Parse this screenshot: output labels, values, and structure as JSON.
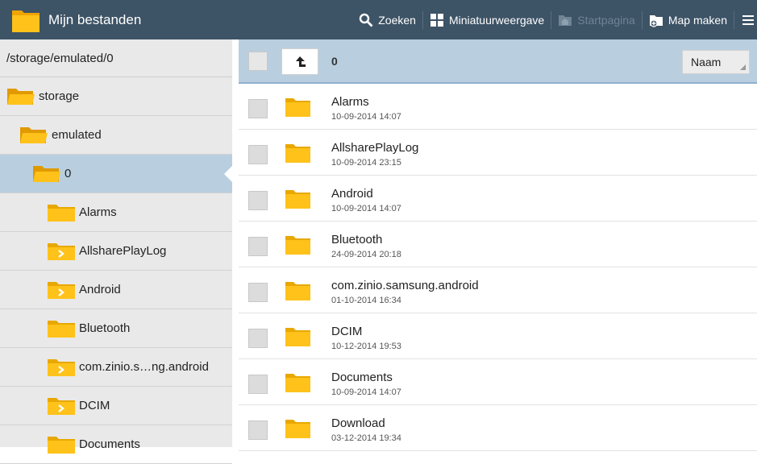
{
  "app": {
    "title": "Mijn bestanden"
  },
  "actions": [
    {
      "label": "Zoeken",
      "icon": "search-icon"
    },
    {
      "label": "Miniatuurweergave",
      "icon": "grid-icon"
    },
    {
      "label": "Startpagina",
      "icon": "home-folder-icon",
      "disabled": true
    },
    {
      "label": "Map maken",
      "icon": "new-folder-icon"
    }
  ],
  "tree": {
    "path": "/storage/emulated/0",
    "items": [
      {
        "label": "storage",
        "level": 0,
        "open": true
      },
      {
        "label": "emulated",
        "level": 1,
        "open": true
      },
      {
        "label": "0",
        "level": 2,
        "open": true,
        "selected": true
      },
      {
        "label": "Alarms",
        "level": 3,
        "expandable": false
      },
      {
        "label": "AllsharePlayLog",
        "level": 3,
        "expandable": true
      },
      {
        "label": "Android",
        "level": 3,
        "expandable": true
      },
      {
        "label": "Bluetooth",
        "level": 3,
        "expandable": false
      },
      {
        "label": "com.zinio.s…ng.android",
        "level": 3,
        "expandable": true
      },
      {
        "label": "DCIM",
        "level": 3,
        "expandable": true
      },
      {
        "label": "Documents",
        "level": 3,
        "expandable": false
      }
    ]
  },
  "list": {
    "current_dir": "0",
    "sort_label": "Naam",
    "files": [
      {
        "name": "Alarms",
        "date": "10-09-2014 14:07"
      },
      {
        "name": "AllsharePlayLog",
        "date": "10-09-2014 23:15"
      },
      {
        "name": "Android",
        "date": "10-09-2014 14:07"
      },
      {
        "name": "Bluetooth",
        "date": "24-09-2014 20:18"
      },
      {
        "name": "com.zinio.samsung.android",
        "date": "01-10-2014 16:34"
      },
      {
        "name": "DCIM",
        "date": "10-12-2014 19:53"
      },
      {
        "name": "Documents",
        "date": "10-09-2014 14:07"
      },
      {
        "name": "Download",
        "date": "03-12-2014 19:34"
      }
    ]
  },
  "colors": {
    "actionbar": "#3d5366",
    "selected": "#b9cfe0",
    "folder": "#f5b800"
  }
}
